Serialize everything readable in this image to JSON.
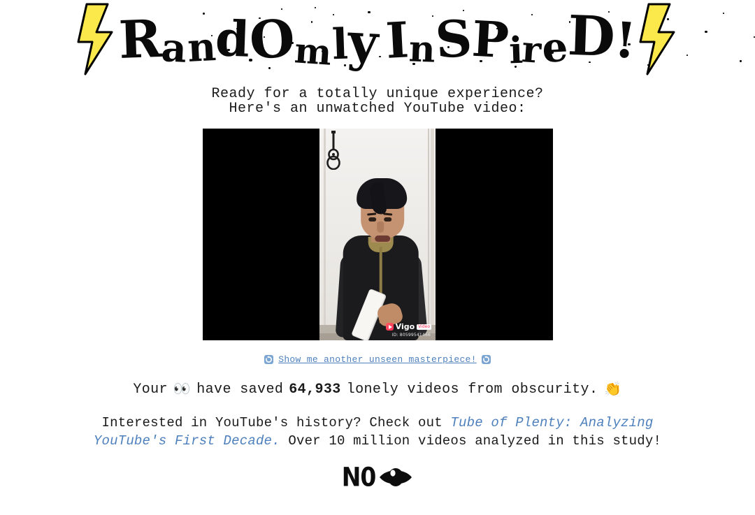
{
  "page": {
    "background_color": "#ffffff",
    "text_color": "#1a1a1a",
    "link_color": "#4e80bd"
  },
  "header": {
    "title": "RandOmly InSPireD!",
    "title_chars": [
      "R",
      "a",
      "n",
      "d",
      "O",
      "m",
      "l",
      "y",
      " ",
      "I",
      "n",
      "S",
      "P",
      "i",
      "r",
      "e",
      "D",
      "!"
    ],
    "left_bolt_icon": "lightning-bolt-icon",
    "right_bolt_icon": "lightning-bolt-icon",
    "bolt_color": "#fbe94b"
  },
  "intro": {
    "line1": "Ready for a totally unique experience?",
    "line2": "Here's an unwatched YouTube video:"
  },
  "video": {
    "aria_label": "unwatched YouTube video player",
    "watermark_brand": "Vigo",
    "watermark_badge": "Video",
    "watermark_id": "ID: 80599541466",
    "letterbox_color": "#000000"
  },
  "refresh": {
    "left_icon": "recycle-icon",
    "right_icon": "recycle-icon",
    "label": "Show me another unseen masterpiece!"
  },
  "counter": {
    "prefix": "Your",
    "eyes_emoji": "👀",
    "middle": "have saved",
    "value": "64,933",
    "suffix": "lonely videos from obscurity.",
    "clap_emoji": "👏"
  },
  "history": {
    "lead": "Interested in YouTube's history? Check out ",
    "link_text": "Tube of Plenty: Analyzing YouTube's First Decade.",
    "tail": " Over 10 million videos analyzed in this study!"
  },
  "footer": {
    "logo_text": "N0",
    "logo_icon": "eye-icon"
  }
}
